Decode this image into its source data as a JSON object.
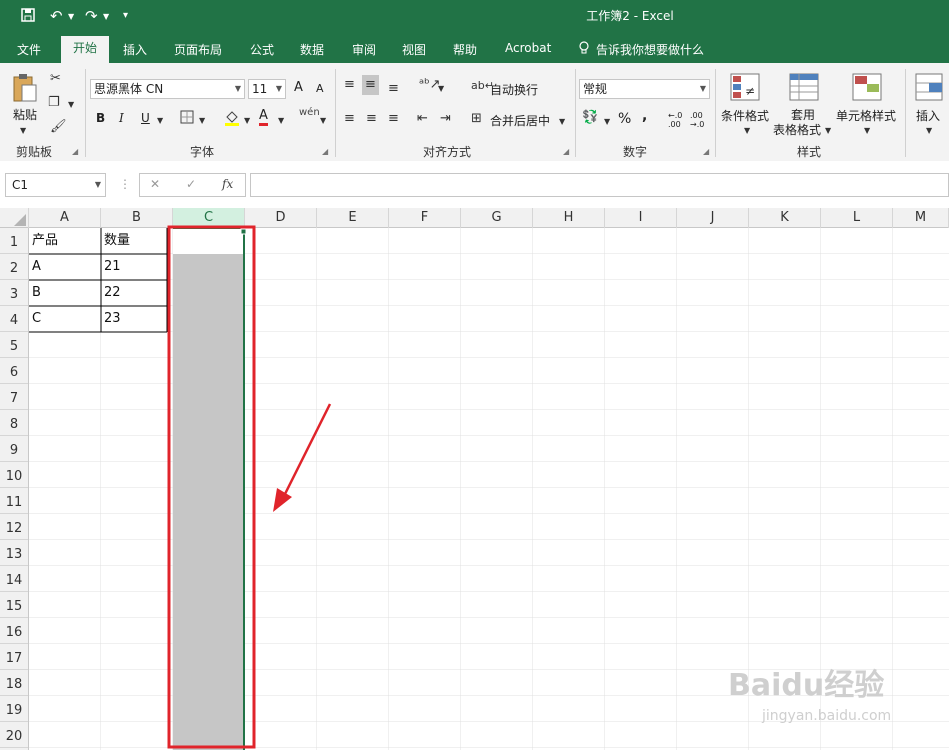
{
  "window": {
    "title": "工作簿2 - Excel"
  },
  "tabs": [
    {
      "label": "文件"
    },
    {
      "label": "开始"
    },
    {
      "label": "插入"
    },
    {
      "label": "页面布局"
    },
    {
      "label": "公式"
    },
    {
      "label": "数据"
    },
    {
      "label": "审阅"
    },
    {
      "label": "视图"
    },
    {
      "label": "帮助"
    },
    {
      "label": "Acrobat"
    }
  ],
  "tell_me": "告诉我你想要做什么",
  "ribbon": {
    "clipboard": {
      "paste_label": "粘贴",
      "group_label": "剪贴板"
    },
    "font": {
      "font_name": "思源黑体 CN",
      "font_size": "11",
      "bold": "B",
      "italic": "I",
      "underline": "U",
      "grow": "A",
      "shrink": "A",
      "font_color": "A",
      "phonetic": "wén",
      "group_label": "字体"
    },
    "alignment": {
      "wrap_text": "自动换行",
      "merge_center": "合并后居中",
      "group_label": "对齐方式"
    },
    "number": {
      "format": "常规",
      "percent": "%",
      "comma": ",",
      "inc_decimal": ".00",
      "dec_decimal": ".00",
      "group_label": "数字"
    },
    "styles": {
      "conditional": "条件格式",
      "table_fmt_1": "套用",
      "table_fmt_2": "表格格式",
      "cell_styles": "单元格样式",
      "group_label": "样式"
    },
    "cells": {
      "insert": "插入"
    }
  },
  "formula_bar": {
    "name_box": "C1",
    "fx_label": "fx",
    "cancel": "✕",
    "enter": "✓",
    "value": ""
  },
  "columns": [
    "A",
    "B",
    "C",
    "D",
    "E",
    "F",
    "G",
    "H",
    "I",
    "J",
    "K",
    "L",
    "M"
  ],
  "rows": [
    "1",
    "2",
    "3",
    "4",
    "5",
    "6",
    "7",
    "8",
    "9",
    "10",
    "11",
    "12",
    "13",
    "14",
    "15",
    "16",
    "17",
    "18",
    "19",
    "20"
  ],
  "cell_data": [
    [
      "产品",
      "数量"
    ],
    [
      "A",
      "21"
    ],
    [
      "B",
      "22"
    ],
    [
      "C",
      "23"
    ]
  ],
  "selected_column": "C",
  "watermark": {
    "brand": "Baidu经验",
    "url": "jingyan.baidu.com"
  },
  "colors": {
    "excel_green": "#217346",
    "annotation_red": "#e0242b",
    "selection_gray": "#c6c6c6"
  }
}
